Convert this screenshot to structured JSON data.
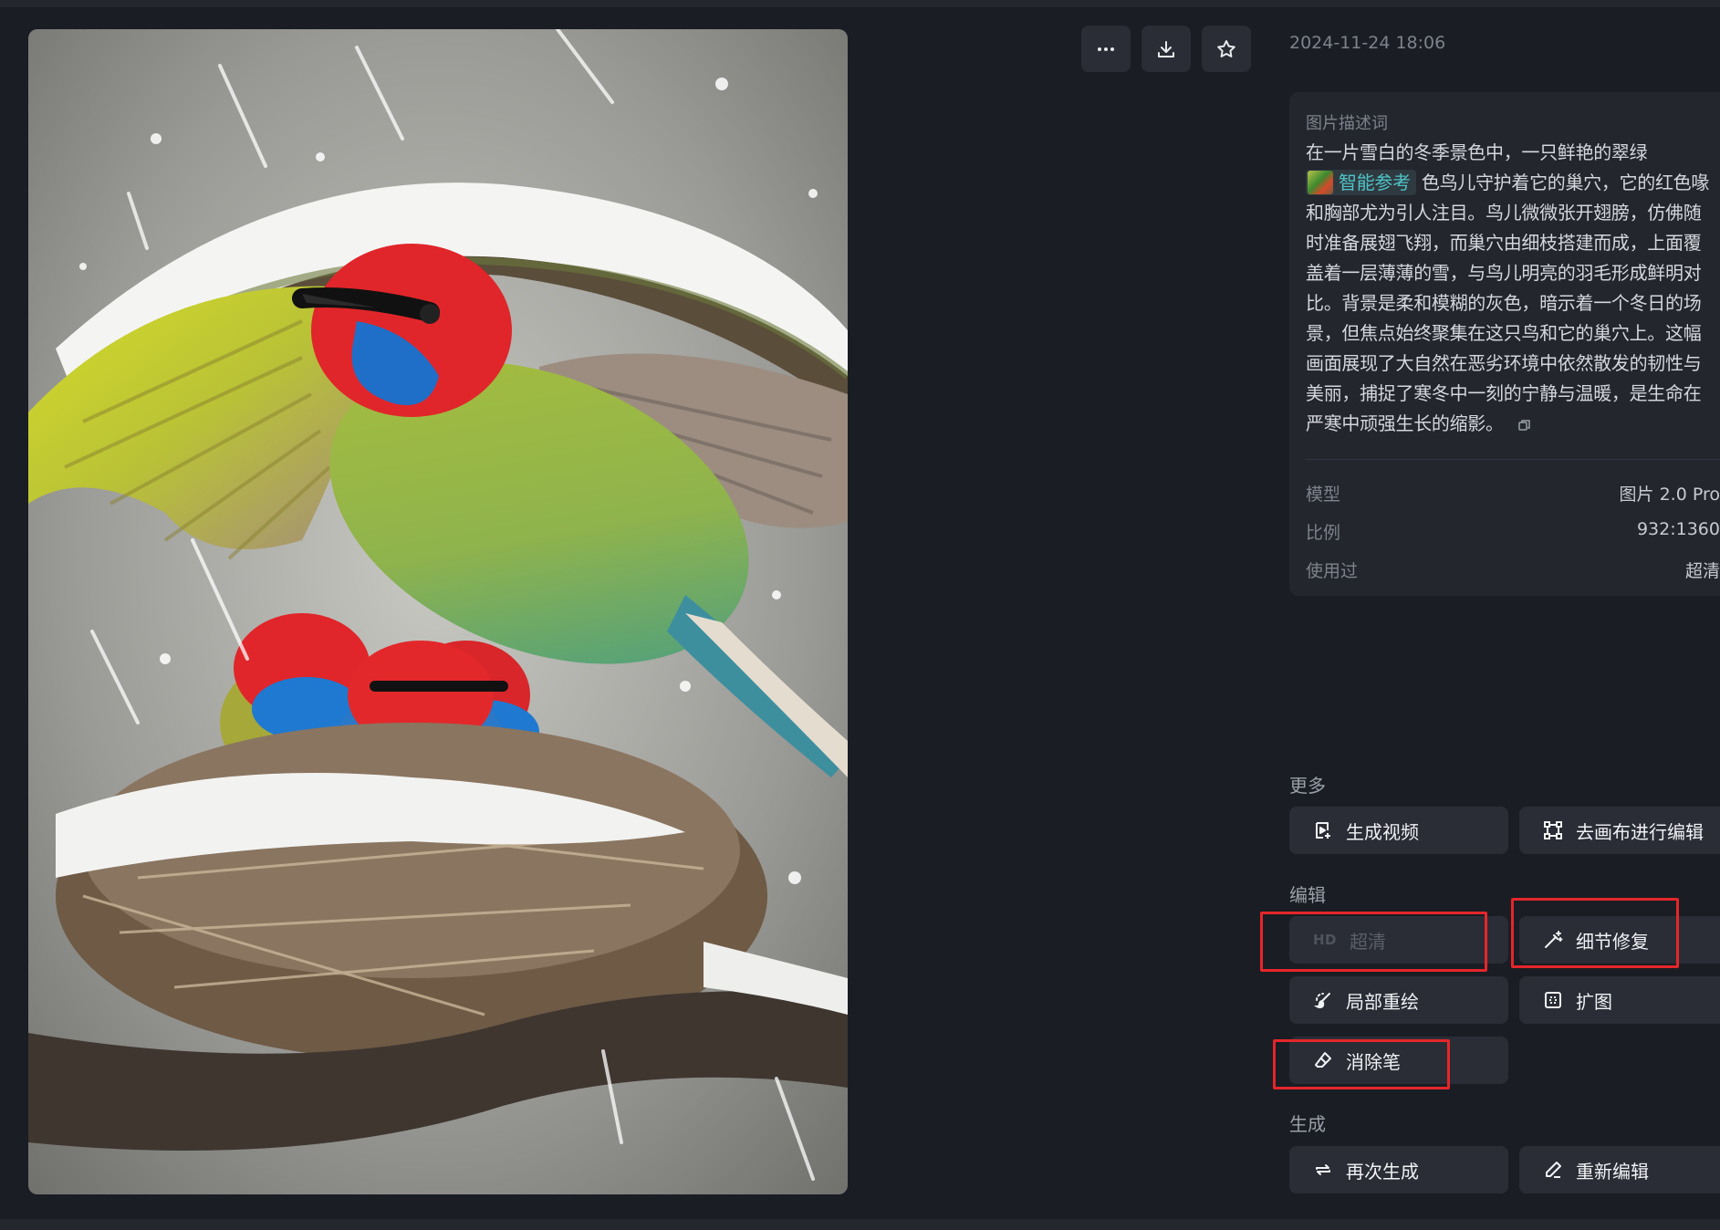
{
  "toolbar": {
    "more_icon": "more-horizontal-icon",
    "download_icon": "download-icon",
    "favorite_icon": "star-icon"
  },
  "timestamp": "2024-11-24 18:06",
  "description": {
    "label": "图片描述词",
    "text_before": "在一片雪白的冬季景色中，一只鲜艳的翠绿",
    "chip_label": "智能参考",
    "text_after": "色鸟儿守护着它的巢穴，它的红色喙和胸部尤为引人注目。鸟儿微微张开翅膀，仿佛随时准备展翅飞翔，而巢穴由细枝搭建而成，上面覆盖着一层薄薄的雪，与鸟儿明亮的羽毛形成鲜明对比。背景是柔和模糊的灰色，暗示着一个冬日的场景，但焦点始终聚集在这只鸟和它的巢穴上。这幅画面展现了大自然在恶劣环境中依然散发的韧性与美丽，捕捉了寒冬中一刻的宁静与温暖，是生命在严寒中顽强生长的缩影。"
  },
  "meta": [
    {
      "key": "模型",
      "value": "图片 2.0 Pro"
    },
    {
      "key": "比例",
      "value": "932:1360"
    },
    {
      "key": "使用过",
      "value": "超清"
    }
  ],
  "sections": {
    "more": {
      "title": "更多",
      "buttons": [
        {
          "label": "生成视频",
          "icon": "video-generate-icon"
        },
        {
          "label": "去画布进行编辑",
          "icon": "canvas-edit-icon"
        }
      ]
    },
    "edit": {
      "title": "编辑",
      "buttons": [
        {
          "label": "超清",
          "badge": "HD",
          "disabled": true
        },
        {
          "label": "细节修复",
          "icon": "magic-wand-icon"
        },
        {
          "label": "局部重绘",
          "icon": "brush-icon"
        },
        {
          "label": "扩图",
          "icon": "expand-icon"
        },
        {
          "label": "消除笔",
          "icon": "eraser-icon"
        }
      ]
    },
    "generate": {
      "title": "生成",
      "buttons": [
        {
          "label": "再次生成",
          "icon": "regenerate-icon"
        },
        {
          "label": "重新编辑",
          "icon": "pencil-icon"
        }
      ]
    }
  },
  "highlight_color": "#e5262b",
  "accent_color": "#4fc3c8"
}
